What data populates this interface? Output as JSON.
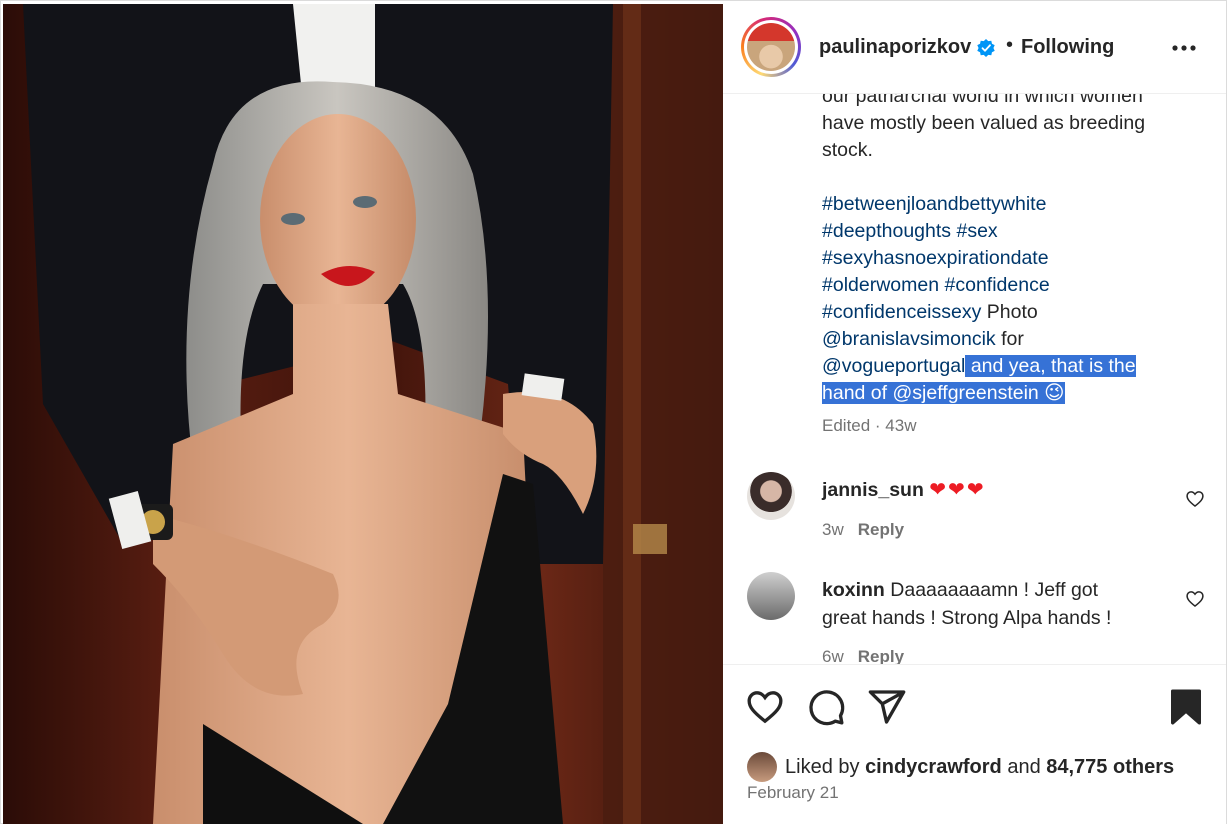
{
  "post": {
    "username": "paulinaporizkov",
    "separator": "•",
    "follow_status": "Following",
    "image_alt": ""
  },
  "caption": {
    "lines": [
      "our patriarchal world in which women",
      "have mostly been valued as breeding",
      "stock."
    ],
    "hashtags": {
      "l1": "#betweenjloandbettywhite",
      "l2a": "#deepthoughts",
      "l2b": "#sex",
      "l3": "#sexyhasnoexpirationdate",
      "l4a": "#olderwomen",
      "l4b": "#confidence",
      "l5": "#confidenceissexy"
    },
    "photo_word": " Photo",
    "mention1": "@branislavsimoncik",
    "for_word": " for",
    "mention2": "@vogueportugal",
    "highlight1": " and yea, that is the",
    "highlight2": "hand of ",
    "mention3": "@sjeffgreenstein",
    "emoji": " 😉",
    "meta": "Edited · 43w"
  },
  "comments": [
    {
      "username": "jannis_sun",
      "text": "❤❤❤",
      "age": "3w",
      "reply_label": "Reply"
    },
    {
      "username": "koxinn",
      "text_line1": " Daaaaaaaamn ! Jeff got",
      "text_line2": "great hands ! Strong Alpa hands !",
      "age": "6w",
      "reply_label": "Reply"
    }
  ],
  "likes": {
    "prefix": "Liked by ",
    "user": "cindycrawford",
    "middle": " and ",
    "count": "84,775 others"
  },
  "date": "February 21",
  "colors": {
    "link": "#00376b",
    "highlight": "#3672d6",
    "verified": "#0095f6",
    "heart": "#ed1c24",
    "muted": "#737373"
  },
  "icons": [
    "more-options-icon",
    "verified-icon",
    "like-icon",
    "comment-icon",
    "share-icon",
    "save-icon",
    "comment-like-icon"
  ]
}
